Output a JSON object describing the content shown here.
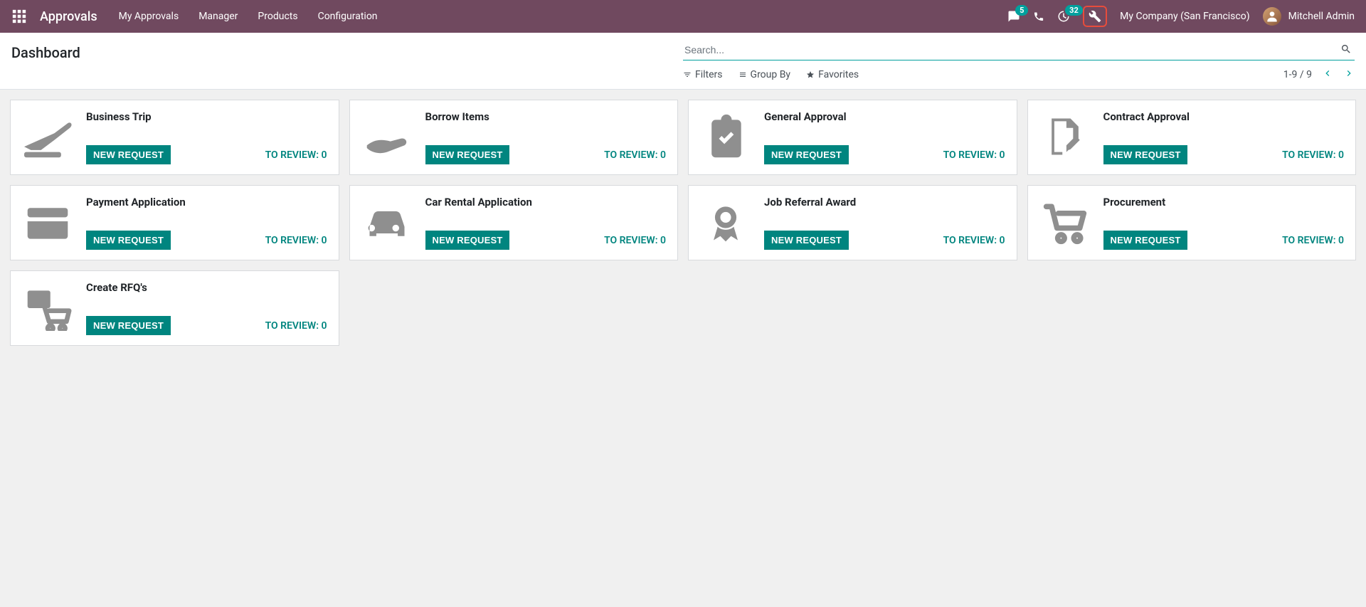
{
  "app": {
    "title": "Approvals"
  },
  "nav": {
    "items": [
      "My Approvals",
      "Manager",
      "Products",
      "Configuration"
    ]
  },
  "header": {
    "messages_badge": "5",
    "activity_badge": "32",
    "company": "My Company (San Francisco)",
    "user": "Mitchell Admin"
  },
  "page": {
    "title": "Dashboard",
    "search_placeholder": "Search...",
    "filters_label": "Filters",
    "groupby_label": "Group By",
    "favorites_label": "Favorites",
    "pager": "1-9 / 9"
  },
  "labels": {
    "new_request": "NEW REQUEST",
    "to_review_prefix": "TO REVIEW: "
  },
  "cards": [
    {
      "title": "Business Trip",
      "to_review": 0,
      "icon": "plane"
    },
    {
      "title": "Borrow Items",
      "to_review": 0,
      "icon": "hand"
    },
    {
      "title": "General Approval",
      "to_review": 0,
      "icon": "clipboard"
    },
    {
      "title": "Contract Approval",
      "to_review": 0,
      "icon": "contract"
    },
    {
      "title": "Payment Application",
      "to_review": 0,
      "icon": "creditcard"
    },
    {
      "title": "Car Rental Application",
      "to_review": 0,
      "icon": "car"
    },
    {
      "title": "Job Referral Award",
      "to_review": 0,
      "icon": "award"
    },
    {
      "title": "Procurement",
      "to_review": 0,
      "icon": "cart"
    },
    {
      "title": "Create RFQ's",
      "to_review": 0,
      "icon": "rfq"
    }
  ]
}
